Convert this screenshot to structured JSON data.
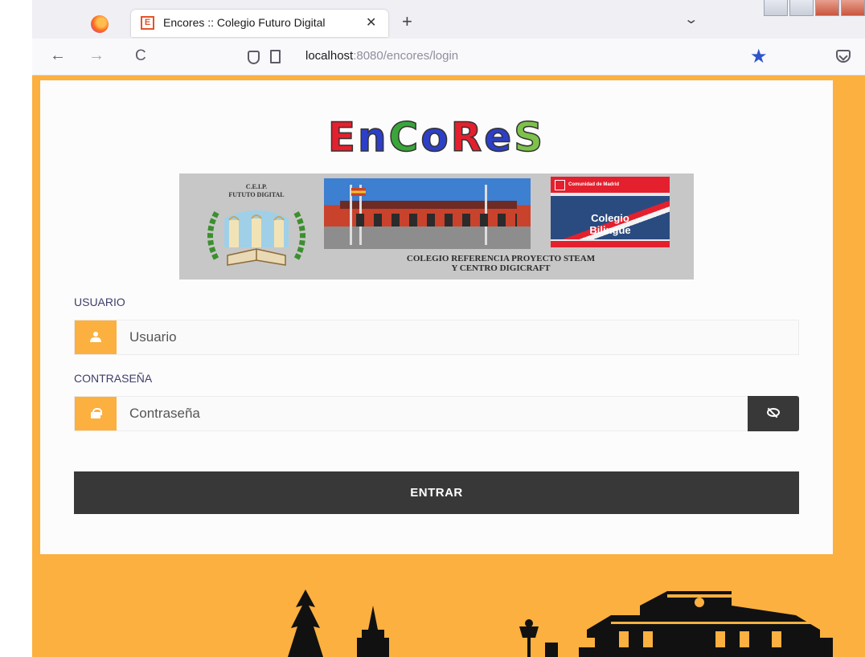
{
  "browser": {
    "tab_title": "Encores :: Colegio Futuro Digital",
    "tab_favicon_letter": "E",
    "tab_close": "✕",
    "new_tab": "+",
    "tab_list": "⌄",
    "back": "←",
    "forward": "→",
    "reload": "C",
    "url_host": "localhost",
    "url_rest": ":8080/encores/login",
    "bookmark_star": "★",
    "menu": "≡"
  },
  "header": {
    "brand_letters": [
      {
        "char": "E",
        "color": "#e4202e"
      },
      {
        "char": "n",
        "color": "#2d3fc7"
      },
      {
        "char": "C",
        "color": "#3aa63a"
      },
      {
        "char": "o",
        "color": "#2d3fc7"
      },
      {
        "char": "R",
        "color": "#e4202e"
      },
      {
        "char": "e",
        "color": "#2d3fc7"
      },
      {
        "char": "S",
        "color": "#7dc24a"
      }
    ],
    "crest_line1": "C.E.I.P.",
    "crest_line2": "FUTUTO DIGITAL",
    "bilingual_top": "Comunidad de Madrid",
    "bilingual_label_1": "Colegio",
    "bilingual_label_2": "Bilingüe",
    "caption_line1": "COLEGIO REFERENCIA PROYECTO STEAM",
    "caption_line2": "Y CENTRO DIGICRAFT"
  },
  "form": {
    "user_label": "USUARIO",
    "user_placeholder": "Usuario",
    "password_label": "CONTRASEÑA",
    "password_placeholder": "Contraseña",
    "submit_label": "ENTRAR"
  },
  "colors": {
    "page_background": "#fbb040",
    "accent": "#fbb040",
    "button": "#383838",
    "star": "#2f55c9"
  }
}
